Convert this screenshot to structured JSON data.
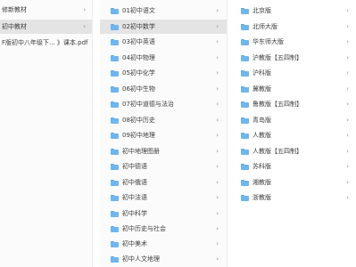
{
  "column1": {
    "items": [
      {
        "label": "修新教材",
        "has_children": true,
        "selected": false
      },
      {
        "label": "初中教材",
        "has_children": true,
        "selected": true
      },
      {
        "label": "F版初中八年级下...  》课本.pdf",
        "has_children": false,
        "selected": false
      }
    ]
  },
  "column2": {
    "items": [
      {
        "label": "01初中语文",
        "selected": false
      },
      {
        "label": "02初中数学",
        "selected": true
      },
      {
        "label": "03初中英语",
        "selected": false
      },
      {
        "label": "04初中物理",
        "selected": false
      },
      {
        "label": "05初中化学",
        "selected": false
      },
      {
        "label": "06初中生物",
        "selected": false
      },
      {
        "label": "07初中道德与法治",
        "selected": false
      },
      {
        "label": "08初中历史",
        "selected": false
      },
      {
        "label": "09初中地理",
        "selected": false
      },
      {
        "label": "初中地理图册",
        "selected": false
      },
      {
        "label": "初中德语",
        "selected": false
      },
      {
        "label": "初中俄语",
        "selected": false
      },
      {
        "label": "初中法语",
        "selected": false
      },
      {
        "label": "初中科学",
        "selected": false
      },
      {
        "label": "初中历史与社会",
        "selected": false
      },
      {
        "label": "初中美术",
        "selected": false
      },
      {
        "label": "初中人文地理",
        "selected": false
      }
    ]
  },
  "column3": {
    "items": [
      {
        "label": "北京版"
      },
      {
        "label": "北师大版"
      },
      {
        "label": "华东师大版"
      },
      {
        "label": "沪教版【五四制】"
      },
      {
        "label": "沪科版"
      },
      {
        "label": "冀教版"
      },
      {
        "label": "鲁教版【五四制】"
      },
      {
        "label": "青岛版"
      },
      {
        "label": "人教版"
      },
      {
        "label": "人教版【五四制】"
      },
      {
        "label": "苏科版"
      },
      {
        "label": "湘教版"
      },
      {
        "label": "浙教版"
      }
    ]
  },
  "icons": {
    "folder": "folder-icon",
    "chevron": "chevron-right-icon",
    "chevron_glyph": "›"
  },
  "colors": {
    "folder": "#6fb5ee",
    "selected_row": "#e4e4e4"
  }
}
